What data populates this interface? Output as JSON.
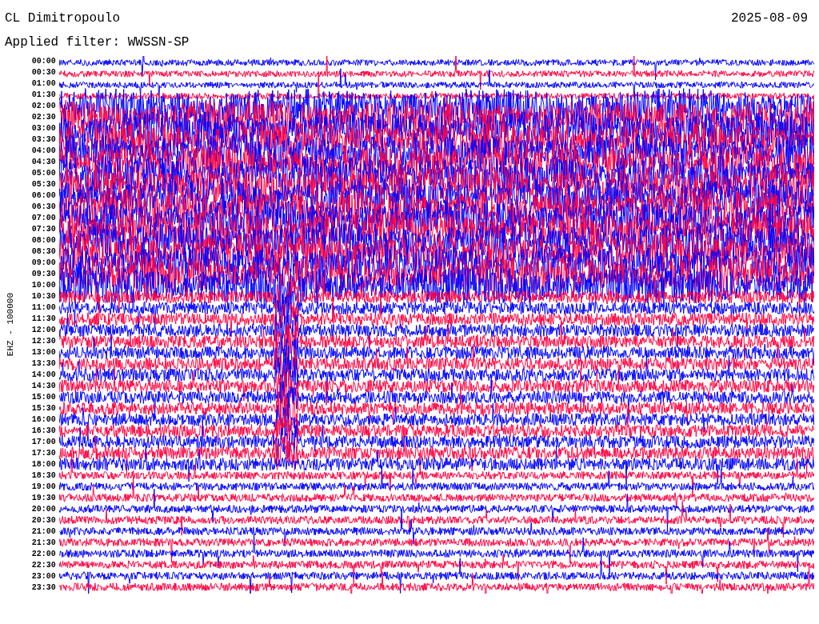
{
  "header": {
    "station": "CL Dimitropoulo",
    "date": "2025-08-09",
    "filter": "Applied filter: WWSSN-SP"
  },
  "axis_label": "EHZ - 100000",
  "rows": [
    {
      "time": "00:00",
      "color": "#0000ff"
    },
    {
      "time": "00:30",
      "color": "#ff0040"
    },
    {
      "time": "01:00",
      "color": "#0000ff"
    },
    {
      "time": "01:30",
      "color": "#ff0040"
    },
    {
      "time": "02:00",
      "color": "#0000ff"
    },
    {
      "time": "02:30",
      "color": "#ff0040"
    },
    {
      "time": "03:00",
      "color": "#0000ff"
    },
    {
      "time": "03:30",
      "color": "#ff0040"
    },
    {
      "time": "04:00",
      "color": "#0000ff"
    },
    {
      "time": "04:30",
      "color": "#ff0040"
    },
    {
      "time": "05:00",
      "color": "#0000ff"
    },
    {
      "time": "05:30",
      "color": "#ff0040"
    },
    {
      "time": "06:00",
      "color": "#0000ff"
    },
    {
      "time": "06:30",
      "color": "#ff0040"
    },
    {
      "time": "07:00",
      "color": "#0000ff"
    },
    {
      "time": "07:30",
      "color": "#ff0040"
    },
    {
      "time": "08:00",
      "color": "#0000ff"
    },
    {
      "time": "08:30",
      "color": "#ff0040"
    },
    {
      "time": "09:00",
      "color": "#0000ff"
    },
    {
      "time": "09:30",
      "color": "#ff0040"
    },
    {
      "time": "10:00",
      "color": "#0000ff"
    },
    {
      "time": "10:30",
      "color": "#ff0040"
    },
    {
      "time": "11:00",
      "color": "#0000ff"
    },
    {
      "time": "11:30",
      "color": "#ff0040"
    },
    {
      "time": "12:00",
      "color": "#0000ff"
    },
    {
      "time": "12:30",
      "color": "#ff0040"
    },
    {
      "time": "13:00",
      "color": "#0000ff"
    },
    {
      "time": "13:30",
      "color": "#ff0040"
    },
    {
      "time": "14:00",
      "color": "#0000ff"
    },
    {
      "time": "14:30",
      "color": "#ff0040"
    },
    {
      "time": "15:00",
      "color": "#0000ff"
    },
    {
      "time": "15:30",
      "color": "#ff0040"
    },
    {
      "time": "16:00",
      "color": "#0000ff"
    },
    {
      "time": "16:30",
      "color": "#ff0040"
    },
    {
      "time": "17:00",
      "color": "#0000ff"
    },
    {
      "time": "17:30",
      "color": "#ff0040"
    },
    {
      "time": "18:00",
      "color": "#0000ff"
    },
    {
      "time": "18:30",
      "color": "#ff0040"
    },
    {
      "time": "19:00",
      "color": "#0000ff"
    },
    {
      "time": "19:30",
      "color": "#ff0040"
    },
    {
      "time": "20:00",
      "color": "#0000ff"
    },
    {
      "time": "20:30",
      "color": "#ff0040"
    },
    {
      "time": "21:00",
      "color": "#0000ff"
    },
    {
      "time": "21:30",
      "color": "#ff0040"
    },
    {
      "time": "22:00",
      "color": "#0000ff"
    },
    {
      "time": "22:30",
      "color": "#ff0040"
    },
    {
      "time": "23:00",
      "color": "#0000ff"
    },
    {
      "time": "23:30",
      "color": "#ff0040"
    }
  ]
}
